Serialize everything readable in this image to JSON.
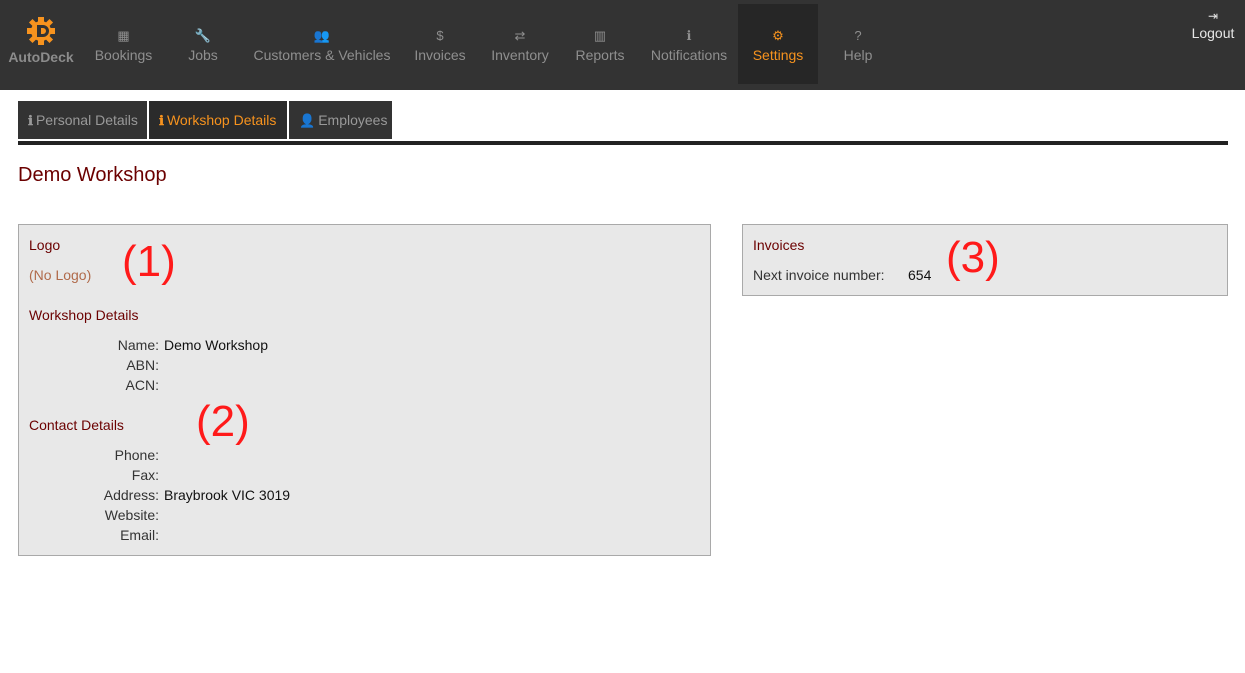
{
  "app": {
    "name": "AutoDeck"
  },
  "nav": {
    "items": [
      {
        "label": "Bookings",
        "icon": "▦",
        "icon_name": "calendar-icon"
      },
      {
        "label": "Jobs",
        "icon": "🔧",
        "icon_name": "wrench-icon"
      },
      {
        "label": "Customers & Vehicles",
        "icon": "👥",
        "icon_name": "users-icon"
      },
      {
        "label": "Invoices",
        "icon": "$",
        "icon_name": "dollar-icon"
      },
      {
        "label": "Inventory",
        "icon": "⇄",
        "icon_name": "retweet-icon"
      },
      {
        "label": "Reports",
        "icon": "▥",
        "icon_name": "bar-chart-icon"
      },
      {
        "label": "Notifications",
        "icon": "ℹ",
        "icon_name": "info-circle-icon"
      },
      {
        "label": "Settings",
        "icon": "⚙",
        "icon_name": "cogs-icon"
      },
      {
        "label": "Help",
        "icon": "?",
        "icon_name": "question-icon"
      }
    ],
    "active": "Settings",
    "logout": {
      "label": "Logout",
      "icon": "⇥",
      "icon_name": "sign-out-icon"
    }
  },
  "tabs": {
    "items": [
      {
        "label": "Personal Details",
        "icon": "ℹ",
        "icon_name": "info-icon"
      },
      {
        "label": "Workshop Details",
        "icon": "ℹ",
        "icon_name": "info-icon"
      },
      {
        "label": "Employees",
        "icon": "👤",
        "icon_name": "user-icon"
      }
    ],
    "active": "Workshop Details"
  },
  "page": {
    "title": "Demo Workshop"
  },
  "workshop_panel": {
    "logo_title": "Logo",
    "logo_value": "(No Logo)",
    "details_title": "Workshop Details",
    "details": [
      {
        "label": "Name:",
        "value": "Demo Workshop"
      },
      {
        "label": "ABN:",
        "value": ""
      },
      {
        "label": "ACN:",
        "value": ""
      }
    ],
    "contact_title": "Contact Details",
    "contact": [
      {
        "label": "Phone:",
        "value": ""
      },
      {
        "label": "Fax:",
        "value": ""
      },
      {
        "label": "Address:",
        "value": "Braybrook VIC 3019"
      },
      {
        "label": "Website:",
        "value": ""
      },
      {
        "label": "Email:",
        "value": ""
      }
    ]
  },
  "invoices_panel": {
    "title": "Invoices",
    "next_number_label": "Next invoice number:",
    "next_number_value": "654"
  },
  "annotations": [
    "(1)",
    "(2)",
    "(3)"
  ],
  "colors": {
    "nav_bg": "#333333",
    "accent": "#f7931e",
    "heading": "#6b0000",
    "annotation": "#ff1a1a",
    "panel_bg": "#e8e8e8"
  }
}
